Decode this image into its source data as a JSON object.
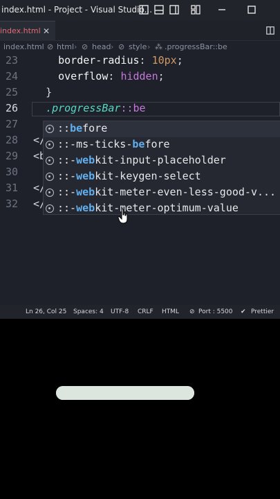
{
  "titlebar": {
    "title": "index.html - Project - Visual Studio..."
  },
  "tabs": [
    {
      "label": "index.html"
    }
  ],
  "breadcrumb": {
    "items": [
      "index.html",
      "html",
      "head",
      "style",
      ".progressBar::be"
    ]
  },
  "code": {
    "lines": [
      {
        "number": "23",
        "indent": "    ",
        "tokens": [
          {
            "cls": "prop",
            "text": "border-radius"
          },
          {
            "cls": "punc",
            "text": ": "
          },
          {
            "cls": "num",
            "text": "10px"
          },
          {
            "cls": "punc",
            "text": ";"
          }
        ]
      },
      {
        "number": "24",
        "indent": "    ",
        "tokens": [
          {
            "cls": "prop",
            "text": "overflow"
          },
          {
            "cls": "punc",
            "text": ": "
          },
          {
            "cls": "kw",
            "text": "hidden"
          },
          {
            "cls": "punc",
            "text": ";"
          }
        ]
      },
      {
        "number": "25",
        "indent": "  ",
        "tokens": [
          {
            "cls": "punc",
            "text": "}"
          }
        ]
      },
      {
        "number": "26",
        "indent": "  ",
        "tokens": [
          {
            "cls": "sel",
            "text": ".progressBar"
          },
          {
            "cls": "pseudo",
            "text": "::be"
          }
        ]
      },
      {
        "number": "27",
        "indent": "",
        "tokens": []
      },
      {
        "number": "28",
        "indent": "",
        "tokens": [
          {
            "cls": "punc",
            "text": "</"
          }
        ]
      },
      {
        "number": "29",
        "indent": "",
        "tokens": [
          {
            "cls": "punc",
            "text": "<b"
          }
        ]
      },
      {
        "number": "30",
        "indent": "",
        "tokens": []
      },
      {
        "number": "31",
        "indent": "",
        "tokens": [
          {
            "cls": "punc",
            "text": "</"
          }
        ]
      },
      {
        "number": "32",
        "indent": "",
        "tokens": [
          {
            "cls": "punc",
            "text": "</"
          }
        ]
      }
    ],
    "active_line": "26"
  },
  "autocomplete": {
    "items": [
      {
        "before": "::",
        "match": "be",
        "after": "fore"
      },
      {
        "before": "::-ms-ticks-",
        "match": "be",
        "after": "fore"
      },
      {
        "before": "::-",
        "match": "web",
        "after": "kit-input-placeholder"
      },
      {
        "before": "::-",
        "match": "web",
        "after": "kit-keygen-select"
      },
      {
        "before": "::-",
        "match": "web",
        "after": "kit-meter-even-less-good-v..."
      },
      {
        "before": "::-",
        "match": "web",
        "after": "kit-meter-optimum-value"
      }
    ]
  },
  "statusbar": {
    "position": "Ln 26, Col 25",
    "spaces": "Spaces: 4",
    "encoding": "UTF-8",
    "eol": "CRLF",
    "language": "HTML",
    "port": "Port : 5500",
    "formatter": "Prettier"
  },
  "preview": {
    "progress_fraction": 1.0,
    "bar_color": "#dde6de"
  },
  "colors": {
    "editor_bg": "#1e2129",
    "selector": "#56d7c4",
    "match_highlight": "#61afef",
    "number": "#d19a66"
  }
}
